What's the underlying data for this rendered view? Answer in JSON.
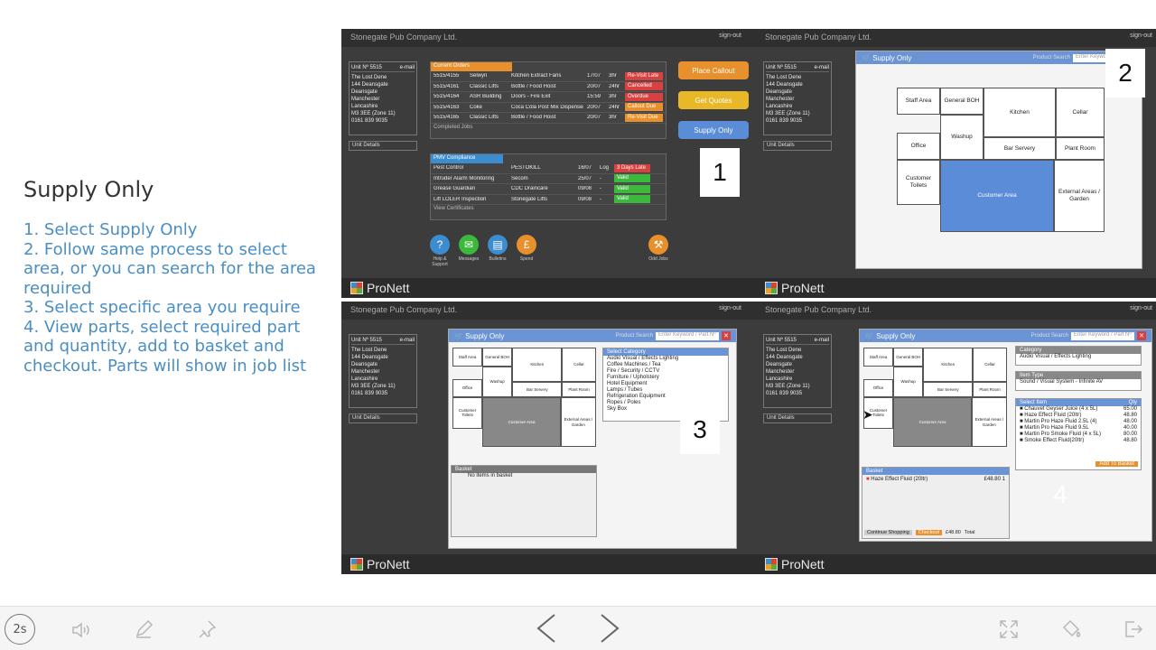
{
  "slide": {
    "title": "Supply Only",
    "steps": [
      "1. Select Supply Only",
      "2. Follow same process to select area, or you can search for the area required",
      "3.  Select specific area you require",
      "4. View parts, select required part and quantity, add to basket and checkout. Parts will show in job list"
    ]
  },
  "app": {
    "company": "Stonegate Pub Company Ltd.",
    "signout": "sign-out",
    "logo": "ProNett",
    "unit": {
      "number": "Unit Nº 5515",
      "email": "e-mail",
      "lines": [
        "The Lost Dene",
        "144 Deansgate",
        "Deansgate",
        "Manchester",
        "Lancashire",
        "M3 3EE (Zone 11)",
        "0161 839 9035"
      ],
      "details": "Unit Details"
    }
  },
  "screen1": {
    "current_orders": "Current Orders",
    "due_header": "Due",
    "status_header": "Status",
    "orders": [
      {
        "ref": "5515/4155",
        "who": "Selwyn",
        "item": "Kitchen Extract Fans",
        "date": "17/07",
        "hrs": "3hr",
        "status": "Re-Visit Late",
        "color": "#d94040"
      },
      {
        "ref": "5515/4161",
        "who": "Classic Lifts",
        "item": "Bottle / Food Hoist",
        "date": "20/07",
        "hrs": "24hr",
        "status": "Cancelled",
        "color": "#d94040"
      },
      {
        "ref": "5515/4164",
        "who": "ASR Building",
        "item": "Doors - Fire Exit",
        "date": "15:59",
        "hrs": "3hr",
        "status": "Overdue",
        "color": "#d94040"
      },
      {
        "ref": "5515/4163",
        "who": "Coke",
        "item": "Coca Cola Post Mix Dispenser",
        "date": "20/07",
        "hrs": "24hr",
        "status": "Callout Due",
        "color": "#e8902c"
      },
      {
        "ref": "5515/4165",
        "who": "Classic Lifts",
        "item": "Bottle / Food Hoist",
        "date": "20/07",
        "hrs": "3hr",
        "status": "Re-Visit Due",
        "color": "#e8902c"
      }
    ],
    "completed_jobs": "Completed Jobs",
    "pmv_title": "PMV Compliance",
    "pmv": [
      {
        "name": "Pest Control",
        "who": "PESTOKILL",
        "date": "16/07",
        "log": "Log",
        "status": "3 Days Late",
        "color": "#d94040"
      },
      {
        "name": "Intruder Alarm Monitoring",
        "who": "Secom",
        "date": "25/07",
        "log": "-",
        "status": "Valid",
        "color": "#3cb83c"
      },
      {
        "name": "Grease Guardian",
        "who": "CDC Draincare",
        "date": "09/08",
        "log": "-",
        "status": "Valid",
        "color": "#3cb83c"
      },
      {
        "name": "Lift LOLER Inspection",
        "who": "Stonegate Lifts",
        "date": "09/08",
        "log": "-",
        "status": "Valid",
        "color": "#3cb83c"
      }
    ],
    "view_certificates": "View Certificates",
    "buttons": {
      "callout": "Place Callout",
      "quotes": "Get Quotes",
      "supply": "Supply Only"
    },
    "icons": [
      {
        "label": "Help & Support",
        "glyph": "?",
        "color": "#3c8cd0"
      },
      {
        "label": "Messages",
        "glyph": "✉",
        "color": "#3cb83c"
      },
      {
        "label": "Bulletins",
        "glyph": "▤",
        "color": "#3c8cd0"
      },
      {
        "label": "Spend",
        "glyph": "£",
        "color": "#e8902c"
      },
      {
        "label": "Odd Jobs",
        "glyph": "⚒",
        "color": "#e8902c"
      }
    ],
    "marker": "1"
  },
  "dialog": {
    "title": "Supply Only",
    "search_label": "Product Search",
    "search_placeholder": "Enter Keyword / Part Nº"
  },
  "rooms": {
    "staff": "Staff Area",
    "boh": "General BOH",
    "kitchen": "Kitchen",
    "cellar": "Cellar",
    "office": "Office",
    "washup": "Washup",
    "bar": "Bar Servery",
    "plant": "Plant Room",
    "toilets": "Customer Toilets",
    "customer": "Customer Area",
    "external": "External Areas / Garden"
  },
  "screen2": {
    "marker": "2"
  },
  "screen3": {
    "marker": "3",
    "select_category": "Select Category",
    "categories": [
      "Audio Visual / Effects Lighting",
      "Coffee Machines / Tea",
      "Fire / Security / CCTV",
      "Furniture / Upholstery",
      "Hotel Equipment",
      "Lamps / Tubes",
      "Refrigeration Equipment",
      "Ropes / Poles",
      "Sky Box"
    ],
    "basket": "Basket",
    "no_items": "No items in basket"
  },
  "screen4": {
    "marker": "4",
    "category_label": "Category",
    "category": "Audio Visual / Effects Lighting",
    "item_type_label": "Item Type",
    "item_type": "Sound / Visual System - Infinite AV",
    "select_item": "Select Item",
    "qty": "Qty",
    "items": [
      {
        "name": "Chauvet Geyser Juice (4 x 5L)",
        "price": "65.00"
      },
      {
        "name": "Haze Effect Fluid (20ltr)",
        "price": "48.80"
      },
      {
        "name": "Martin Pro Haze Fluid 2.5L (4)",
        "price": "48.00"
      },
      {
        "name": "Martin Pro Haze Fluid 9.5L",
        "price": "40.00"
      },
      {
        "name": "Martin Pro Smoke Fluid (4 x 5L)",
        "price": "80.00"
      },
      {
        "name": "Smoke Effect Fluid(20ltr)",
        "price": "48.80"
      }
    ],
    "add_to_basket": "Add To Basket",
    "basket": "Basket",
    "basket_item": "Haze Effect Fluid (20ltr)",
    "basket_price": "£48.80",
    "basket_qty": "1",
    "continue": "Continue Shopping",
    "checkout": "Checkout",
    "total_value": "£48.80",
    "total_label": "Total"
  },
  "toolbar": {
    "timer": "2s"
  }
}
